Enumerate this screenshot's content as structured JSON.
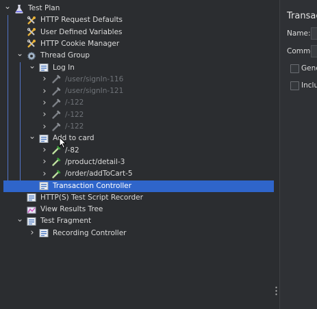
{
  "tree": [
    {
      "label": "Test Plan",
      "icon": "flask-icon",
      "toggle": "expanded",
      "depth": 0,
      "disabled": false
    },
    {
      "label": "HTTP Request Defaults",
      "icon": "wrench-icon",
      "toggle": "none",
      "depth": 1,
      "disabled": false
    },
    {
      "label": "User Defined Variables",
      "icon": "wrench-icon",
      "toggle": "none",
      "depth": 1,
      "disabled": false
    },
    {
      "label": "HTTP Cookie Manager",
      "icon": "wrench-icon",
      "toggle": "none",
      "depth": 1,
      "disabled": false
    },
    {
      "label": "Thread Group",
      "icon": "gear-icon",
      "toggle": "expanded",
      "depth": 1,
      "disabled": false
    },
    {
      "label": "Log In",
      "icon": "controller-icon",
      "toggle": "expanded",
      "depth": 2,
      "disabled": false
    },
    {
      "label": "/user/signIn-116",
      "icon": "pipette-icon",
      "toggle": "collapsed",
      "depth": 3,
      "disabled": true
    },
    {
      "label": "/user/signIn-121",
      "icon": "pipette-icon",
      "toggle": "collapsed",
      "depth": 3,
      "disabled": true
    },
    {
      "label": "/-122",
      "icon": "pipette-icon",
      "toggle": "collapsed",
      "depth": 3,
      "disabled": true
    },
    {
      "label": "/-122",
      "icon": "pipette-icon",
      "toggle": "collapsed",
      "depth": 3,
      "disabled": true
    },
    {
      "label": "/-122",
      "icon": "pipette-icon",
      "toggle": "collapsed",
      "depth": 3,
      "disabled": true
    },
    {
      "label": "Add to card",
      "icon": "controller-icon",
      "toggle": "expanded",
      "depth": 2,
      "disabled": false
    },
    {
      "label": "/-82",
      "icon": "pipette-icon",
      "toggle": "collapsed",
      "depth": 3,
      "disabled": false
    },
    {
      "label": "/product/detail-3",
      "icon": "pipette-icon",
      "toggle": "collapsed",
      "depth": 3,
      "disabled": false
    },
    {
      "label": "/order/addToCart-5",
      "icon": "pipette-icon",
      "toggle": "collapsed",
      "depth": 3,
      "disabled": false
    },
    {
      "label": "Transaction Controller",
      "icon": "controller-icon",
      "toggle": "none",
      "depth": 2,
      "disabled": false,
      "selected": true
    },
    {
      "label": "HTTP(S) Test Script Recorder",
      "icon": "controller-icon",
      "toggle": "none",
      "depth": 1,
      "disabled": false
    },
    {
      "label": "View Results Tree",
      "icon": "chart-icon",
      "toggle": "none",
      "depth": 1,
      "disabled": false
    },
    {
      "label": "Test Fragment",
      "icon": "controller-icon",
      "toggle": "expanded",
      "depth": 1,
      "disabled": false
    },
    {
      "label": "Recording Controller",
      "icon": "controller-icon",
      "toggle": "collapsed",
      "depth": 2,
      "disabled": false
    }
  ],
  "right_panel": {
    "title": "Transac",
    "name_label": "Name:",
    "comments_label": "Comment",
    "checkbox1_label": "Gene",
    "checkbox2_label": "Inclu"
  },
  "colors": {
    "selection": "#2f65ca",
    "background": "#2b2d30",
    "guide": "#5275c8",
    "disabled_text": "#6f7378"
  }
}
